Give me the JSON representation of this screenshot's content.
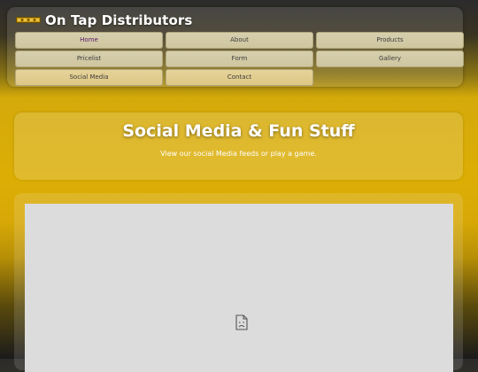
{
  "header": {
    "title": "On Tap Distributors",
    "logo_icon": "brand-logo-icon"
  },
  "nav": {
    "items": [
      {
        "label": "Home",
        "active": true
      },
      {
        "label": "About"
      },
      {
        "label": "Products"
      },
      {
        "label": "Pricelist"
      },
      {
        "label": "Form"
      },
      {
        "label": "Gallery"
      },
      {
        "label": "Social Media"
      },
      {
        "label": "Contact"
      }
    ]
  },
  "hero": {
    "title": "Social Media & Fun Stuff",
    "subtitle": "View our social Media feeds or play a game."
  },
  "embed": {
    "icon": "broken-frame-icon"
  },
  "colors": {
    "accent": "#dcae05",
    "nav_button": "#d6cfae",
    "frame_bg": "#dcdcdc"
  }
}
